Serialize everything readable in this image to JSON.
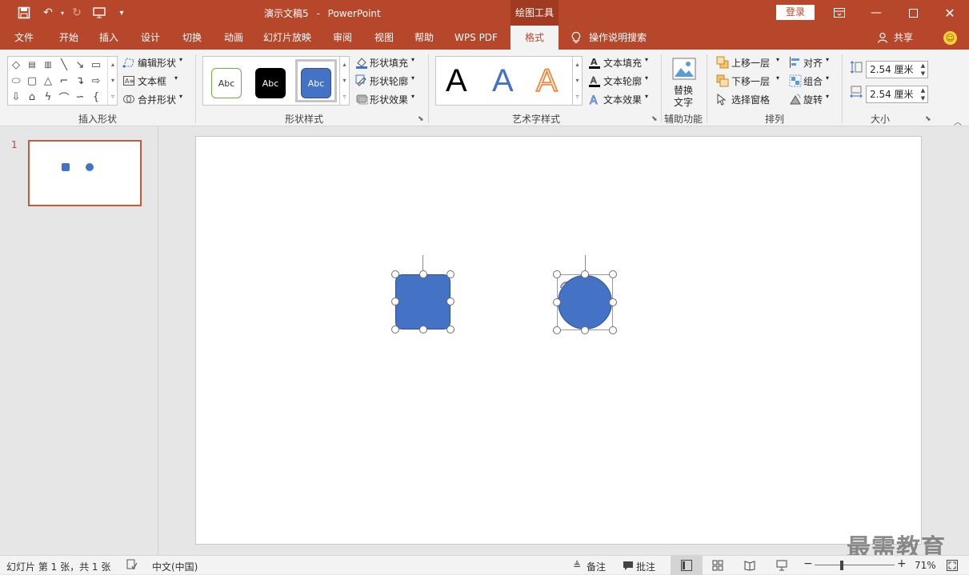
{
  "titlebar": {
    "doc_title": "演示文稿5",
    "separator": "-",
    "app_name": "PowerPoint",
    "context_tab": "绘图工具",
    "login_label": "登录"
  },
  "menu": {
    "items": [
      "文件",
      "开始",
      "插入",
      "设计",
      "切换",
      "动画",
      "幻灯片放映",
      "审阅",
      "视图",
      "帮助",
      "WPS PDF",
      "格式"
    ],
    "active": "格式",
    "tell_me": "操作说明搜索",
    "share": "共享"
  },
  "ribbon": {
    "insert_shapes": {
      "edit_shape": "编辑形状",
      "text_box": "文本框",
      "merge_shapes": "合并形状",
      "label": "插入形状"
    },
    "shape_styles": {
      "sample_text": "Abc",
      "fill": "形状填充",
      "outline": "形状轮廓",
      "effects": "形状效果",
      "label": "形状样式"
    },
    "wordart": {
      "letter": "A",
      "text_fill": "文本填充",
      "text_outline": "文本轮廓",
      "text_effects": "文本效果",
      "label": "艺术字样式"
    },
    "accessibility": {
      "alt_text_line1": "替换",
      "alt_text_line2": "文字",
      "label": "辅助功能"
    },
    "arrange": {
      "bring_forward": "上移一层",
      "send_backward": "下移一层",
      "selection_pane": "选择窗格",
      "align": "对齐",
      "group": "组合",
      "rotate": "旋转",
      "label": "排列"
    },
    "size": {
      "height": "2.54 厘米",
      "width": "2.54 厘米",
      "label": "大小"
    }
  },
  "slides_pane": {
    "slide_number": "1"
  },
  "statusbar": {
    "slide_info": "幻灯片 第 1 张，共 1 张",
    "language": "中文(中国)",
    "notes": "备注",
    "comments": "批注",
    "zoom": "71%"
  },
  "watermark": "最需教育",
  "colors": {
    "accent": "#b7472a",
    "shape_fill": "#4472c4"
  }
}
